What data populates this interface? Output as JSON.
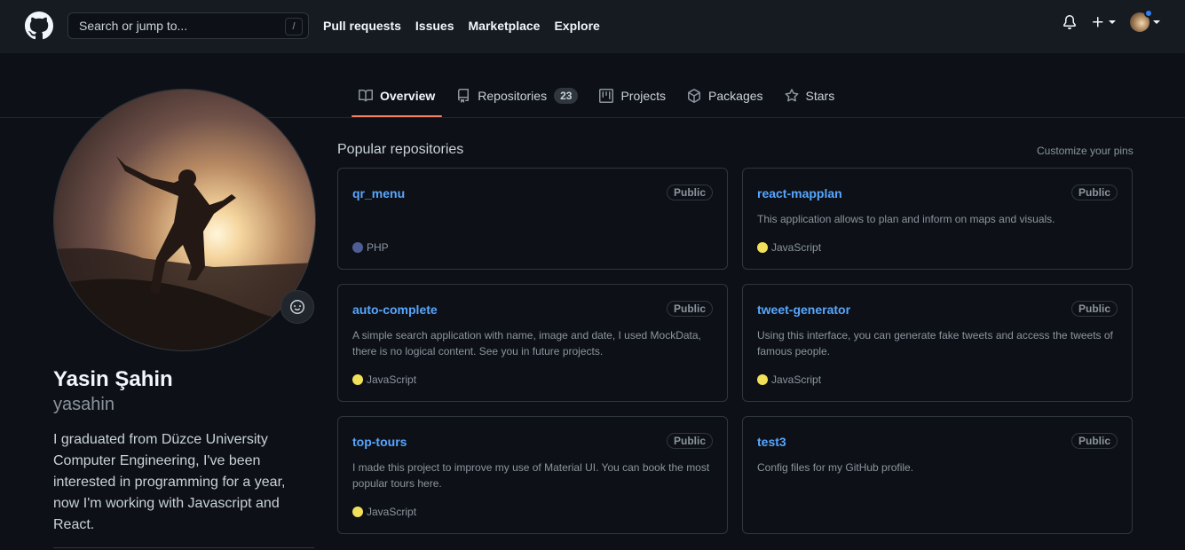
{
  "header": {
    "search_placeholder": "Search or jump to...",
    "search_shortcut": "/",
    "nav": [
      "Pull requests",
      "Issues",
      "Marketplace",
      "Explore"
    ]
  },
  "tabs": [
    {
      "label": "Overview",
      "icon": "book-icon",
      "active": true
    },
    {
      "label": "Repositories",
      "icon": "repo-icon",
      "count": "23"
    },
    {
      "label": "Projects",
      "icon": "project-icon"
    },
    {
      "label": "Packages",
      "icon": "package-icon"
    },
    {
      "label": "Stars",
      "icon": "star-icon"
    }
  ],
  "profile": {
    "name": "Yasin Şahin",
    "username": "yasahin",
    "bio": "I graduated from Düzce University Computer Engineering, I've been interested in programming for a year, now I'm working with Javascript and React."
  },
  "pinned": {
    "title": "Popular repositories",
    "customize": "Customize your pins",
    "repos": [
      {
        "name": "qr_menu",
        "visibility": "Public",
        "description": "",
        "language": "PHP",
        "lang_color": "#4F5D95"
      },
      {
        "name": "react-mapplan",
        "visibility": "Public",
        "description": "This application allows to plan and inform on maps and visuals.",
        "language": "JavaScript",
        "lang_color": "#f1e05a"
      },
      {
        "name": "auto-complete",
        "visibility": "Public",
        "description": "A simple search application with name, image and date, I used MockData, there is no logical content. See you in future projects.",
        "language": "JavaScript",
        "lang_color": "#f1e05a"
      },
      {
        "name": "tweet-generator",
        "visibility": "Public",
        "description": "Using this interface, you can generate fake tweets and access the tweets of famous people.",
        "language": "JavaScript",
        "lang_color": "#f1e05a"
      },
      {
        "name": "top-tours",
        "visibility": "Public",
        "description": "I made this project to improve my use of Material UI. You can book the most popular tours here.",
        "language": "JavaScript",
        "lang_color": "#f1e05a"
      },
      {
        "name": "test3",
        "visibility": "Public",
        "description": "Config files for my GitHub profile.",
        "language": "",
        "lang_color": ""
      }
    ]
  }
}
